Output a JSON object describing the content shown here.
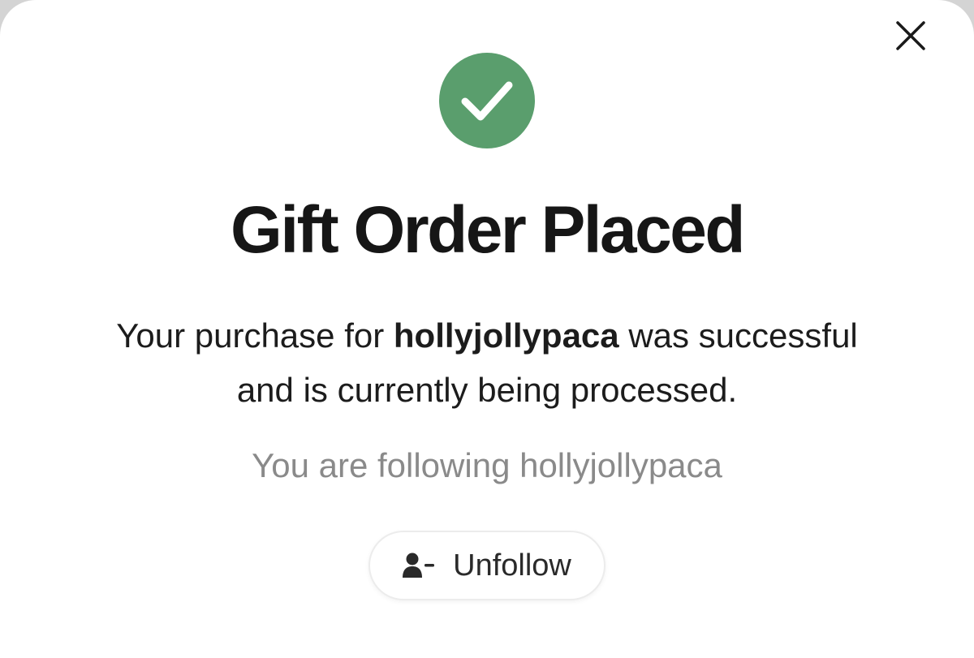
{
  "dialog": {
    "title": "Gift Order Placed",
    "message_prefix": "Your purchase for ",
    "recipient": "hollyjollypaca",
    "message_line1_suffix": " was successful",
    "message_line2": "and is currently being processed.",
    "following_text": "You are following hollyjollypaca",
    "unfollow_label": "Unfollow"
  },
  "icons": {
    "close": "close-icon",
    "success": "check-circle-icon",
    "unfollow": "user-minus-icon"
  },
  "colors": {
    "success_green": "#5a9e6d",
    "title_text": "#161616",
    "muted_text": "#8a8a8a",
    "button_border": "#ececec"
  }
}
